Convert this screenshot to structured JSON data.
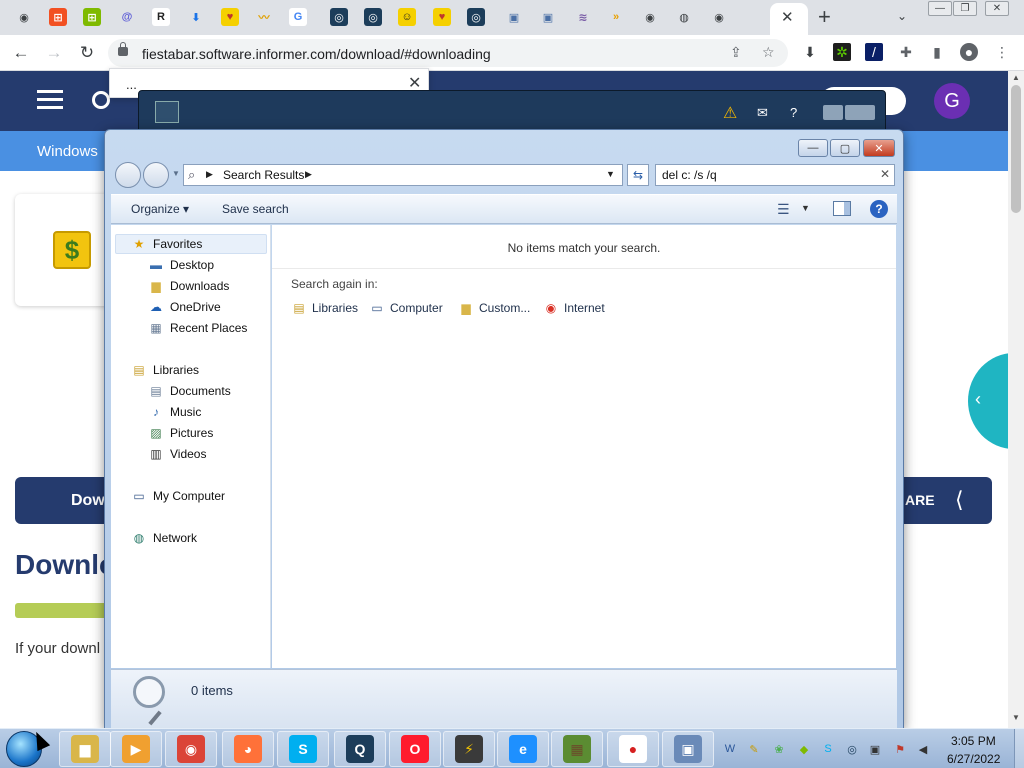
{
  "browser": {
    "url": "fiestabar.software.informer.com/download/#downloading",
    "active_tab_close": "✕",
    "new_tab": "+",
    "tab_favicons": [
      {
        "name": "chrome-favicon-1",
        "glyph": "◉",
        "bg": "#dee1e6",
        "fg": "#3c4043"
      },
      {
        "name": "windows-favicon",
        "glyph": "⊞",
        "bg": "#f25022",
        "fg": "#ffffff"
      },
      {
        "name": "ms-favicon",
        "glyph": "⊞",
        "bg": "#7fba00",
        "fg": "#ffffff"
      },
      {
        "name": "at-favicon",
        "glyph": "@",
        "bg": "#dee1e6",
        "fg": "#5b5bd6"
      },
      {
        "name": "r-favicon",
        "glyph": "R",
        "bg": "#ffffff",
        "fg": "#222222"
      },
      {
        "name": "download-favicon",
        "glyph": "⬇",
        "bg": "#dee1e6",
        "fg": "#1a73e8"
      },
      {
        "name": "heart-favicon",
        "glyph": "♥",
        "bg": "#f5d000",
        "fg": "#c0392b"
      },
      {
        "name": "chart-favicon",
        "glyph": "〰",
        "bg": "#dee1e6",
        "fg": "#e0a000"
      },
      {
        "name": "google-favicon",
        "glyph": "G",
        "bg": "#ffffff",
        "fg": "#4285f4"
      },
      {
        "name": "o-favicon-1",
        "glyph": "◎",
        "bg": "#1c3d5a",
        "fg": "#ffffff"
      },
      {
        "name": "o-favicon-2",
        "glyph": "◎",
        "bg": "#1c3d5a",
        "fg": "#ffffff"
      },
      {
        "name": "smile-favicon",
        "glyph": "☺",
        "bg": "#f5d000",
        "fg": "#222222"
      },
      {
        "name": "heart-favicon-2",
        "glyph": "♥",
        "bg": "#f5d000",
        "fg": "#c0392b"
      },
      {
        "name": "o-favicon-3",
        "glyph": "◎",
        "bg": "#1c3d5a",
        "fg": "#ffffff"
      },
      {
        "name": "box-favicon-1",
        "glyph": "▣",
        "bg": "#dee1e6",
        "fg": "#4a6fa5"
      },
      {
        "name": "box-favicon-2",
        "glyph": "▣",
        "bg": "#dee1e6",
        "fg": "#4a6fa5"
      },
      {
        "name": "wave-favicon",
        "glyph": "≋",
        "bg": "#dee1e6",
        "fg": "#7b5ea7"
      },
      {
        "name": "arrow-favicon",
        "glyph": "»",
        "bg": "#dee1e6",
        "fg": "#e8a000"
      },
      {
        "name": "chrome-favicon-2",
        "glyph": "◉",
        "bg": "#dee1e6",
        "fg": "#3c4043"
      },
      {
        "name": "globe-favicon",
        "glyph": "◍",
        "bg": "#dee1e6",
        "fg": "#3c4043"
      },
      {
        "name": "chrome-favicon-3",
        "glyph": "◉",
        "bg": "#dee1e6",
        "fg": "#3c4043"
      }
    ]
  },
  "site": {
    "avatar_letter": "G",
    "subnav_label": "Windows",
    "dollar": "$",
    "download_button_label": "Dow",
    "share_label": "ARE",
    "heading": "Downlo",
    "text": "If your downl",
    "popup_dots": "..."
  },
  "explorer": {
    "breadcrumb": "Search Results",
    "search_query": "del c: /s /q",
    "organize": "Organize",
    "save_search": "Save search",
    "no_items": "No items match your search.",
    "search_again_label": "Search again in:",
    "search_again_items": [
      {
        "name": "libraries",
        "label": "Libraries",
        "icon": "library-icon",
        "glyph": "▤",
        "color": "#c8a030"
      },
      {
        "name": "computer",
        "label": "Computer",
        "icon": "computer-icon",
        "glyph": "▭",
        "color": "#3a5a8a"
      },
      {
        "name": "custom",
        "label": "Custom...",
        "icon": "folder-icon",
        "glyph": "▆",
        "color": "#d9b64a"
      },
      {
        "name": "internet",
        "label": "Internet",
        "icon": "chrome-icon",
        "glyph": "◉",
        "color": "#d93025"
      }
    ],
    "nav": {
      "favorites": "Favorites",
      "favorites_items": [
        {
          "name": "desktop",
          "label": "Desktop",
          "icon": "desktop-icon",
          "glyph": "▬",
          "color": "#3a6fb0"
        },
        {
          "name": "downloads",
          "label": "Downloads",
          "icon": "downloads-folder-icon",
          "glyph": "▆",
          "color": "#d9b64a"
        },
        {
          "name": "onedrive",
          "label": "OneDrive",
          "icon": "cloud-icon",
          "glyph": "☁",
          "color": "#1e5fb3"
        },
        {
          "name": "recent-places",
          "label": "Recent Places",
          "icon": "recent-places-icon",
          "glyph": "▦",
          "color": "#6a7d96"
        }
      ],
      "libraries": "Libraries",
      "libraries_items": [
        {
          "name": "documents",
          "label": "Documents",
          "icon": "documents-icon",
          "glyph": "▤",
          "color": "#6a7d96"
        },
        {
          "name": "music",
          "label": "Music",
          "icon": "music-icon",
          "glyph": "♪",
          "color": "#3a6fb0"
        },
        {
          "name": "pictures",
          "label": "Pictures",
          "icon": "pictures-icon",
          "glyph": "▨",
          "color": "#3a7a4a"
        },
        {
          "name": "videos",
          "label": "Videos",
          "icon": "videos-icon",
          "glyph": "▥",
          "color": "#333333"
        }
      ],
      "my_computer": "My Computer",
      "network": "Network"
    },
    "status": "0 items"
  },
  "taskbar": {
    "time": "3:05 PM",
    "date": "6/27/2022",
    "apps": [
      {
        "name": "explorer",
        "icon": "explorer-icon",
        "glyph": "▆",
        "bg": "#d9b64a",
        "fg": "#ffffff"
      },
      {
        "name": "media-player",
        "icon": "media-player-icon",
        "glyph": "▶",
        "bg": "#f0a030",
        "fg": "#ffffff"
      },
      {
        "name": "chrome",
        "icon": "chrome-icon",
        "glyph": "◉",
        "bg": "#db4437",
        "fg": "#ffffff"
      },
      {
        "name": "firefox",
        "icon": "firefox-icon",
        "glyph": "◕",
        "bg": "#ff7139",
        "fg": "#ffffff"
      },
      {
        "name": "skype",
        "icon": "skype-icon",
        "glyph": "S",
        "bg": "#00aff0",
        "fg": "#ffffff"
      },
      {
        "name": "search-app",
        "icon": "magnifier-icon",
        "glyph": "Q",
        "bg": "#1c3d5a",
        "fg": "#ffffff"
      },
      {
        "name": "opera",
        "icon": "opera-icon",
        "glyph": "O",
        "bg": "#ff1b2d",
        "fg": "#ffffff"
      },
      {
        "name": "winamp",
        "icon": "lightning-icon",
        "glyph": "⚡",
        "bg": "#3a3a3a",
        "fg": "#f5c400"
      },
      {
        "name": "internet-explorer",
        "icon": "ie-icon",
        "glyph": "e",
        "bg": "#1e90ff",
        "fg": "#ffffff"
      },
      {
        "name": "minecraft",
        "icon": "minecraft-icon",
        "glyph": "▦",
        "bg": "#5b8c32",
        "fg": "#6b4a2a"
      },
      {
        "name": "fruit-app",
        "icon": "apple-icon",
        "glyph": "●",
        "bg": "#ffffff",
        "fg": "#d62020"
      },
      {
        "name": "install-app",
        "icon": "installer-icon",
        "glyph": "▣",
        "bg": "#6a8ab8",
        "fg": "#ffffff"
      }
    ],
    "tray": [
      {
        "name": "word-tray",
        "glyph": "W",
        "color": "#2b579a"
      },
      {
        "name": "pen-tray",
        "glyph": "✎",
        "color": "#c69a00"
      },
      {
        "name": "leaf-tray",
        "glyph": "❀",
        "color": "#4caf50"
      },
      {
        "name": "cube-tray",
        "glyph": "◆",
        "color": "#7fba00"
      },
      {
        "name": "skype-tray",
        "glyph": "S",
        "color": "#00aff0"
      },
      {
        "name": "q-tray",
        "glyph": "◎",
        "color": "#1c3d5a"
      },
      {
        "name": "network-tray",
        "glyph": "▣",
        "color": "#333333"
      },
      {
        "name": "flag-tray",
        "glyph": "⚑",
        "color": "#c0392b"
      },
      {
        "name": "volume-tray",
        "glyph": "◀",
        "color": "#333333"
      }
    ]
  }
}
